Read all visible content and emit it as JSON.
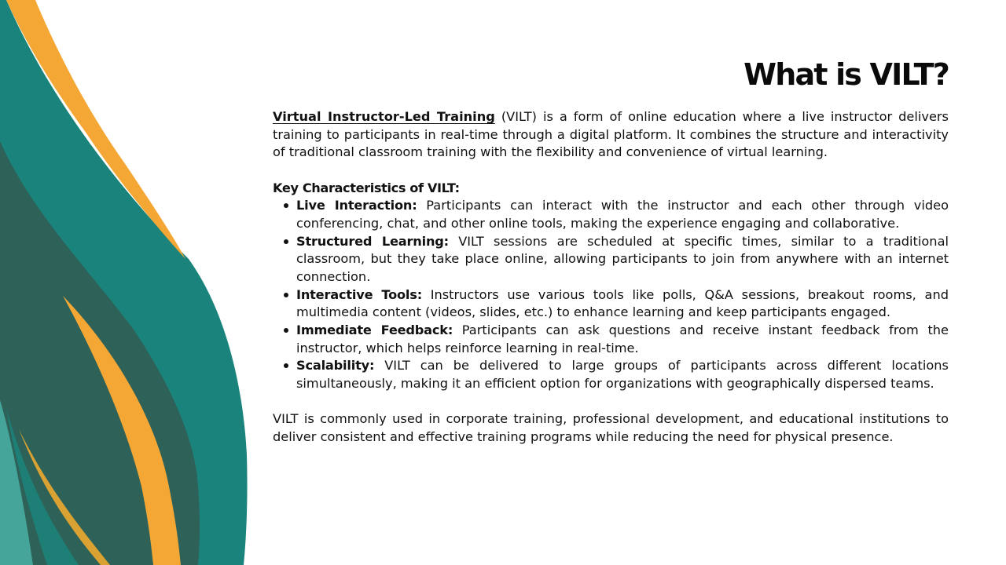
{
  "slide": {
    "title": "What is VILT?",
    "intro": {
      "term": "Virtual Instructor-Led Training",
      "text": " (VILT) is a form of online education where a live instructor delivers training to participants in real-time through a digital platform. It combines the structure and interactivity of traditional classroom training with the flexibility and convenience of virtual learning."
    },
    "key_characteristics": {
      "heading": "Key Characteristics of VILT:",
      "items": [
        {
          "term": "Live Interaction:",
          "text": " Participants can interact with the instructor and each other through video conferencing, chat, and other online tools, making the experience engaging and collaborative."
        },
        {
          "term": "Structured Learning:",
          "text": " VILT sessions are scheduled at specific times, similar to a traditional classroom, but they take place online, allowing participants to join from anywhere with an internet connection."
        },
        {
          "term": "Interactive Tools:",
          "text": " Instructors use various tools like polls, Q&A sessions, breakout rooms, and multimedia content (videos, slides, etc.) to enhance learning and keep participants engaged."
        },
        {
          "term": "Immediate Feedback:",
          "text": " Participants can ask questions and receive instant feedback from the instructor, which helps reinforce learning in real-time."
        },
        {
          "term": "Scalability:",
          "text": " VILT can be delivered to large groups of participants across different locations simultaneously, making it an efficient option for organizations with geographically dispersed teams."
        }
      ]
    },
    "closing": "VILT is commonly used in corporate training, professional development, and educational institutions to deliver consistent and effective training programs while reducing the need for physical presence."
  },
  "theme": {
    "teal": "#1a837b",
    "dark_teal": "#2e6158",
    "light_teal": "#45a59a",
    "orange": "#f4a734",
    "text": "#111111",
    "background": "#ffffff"
  }
}
